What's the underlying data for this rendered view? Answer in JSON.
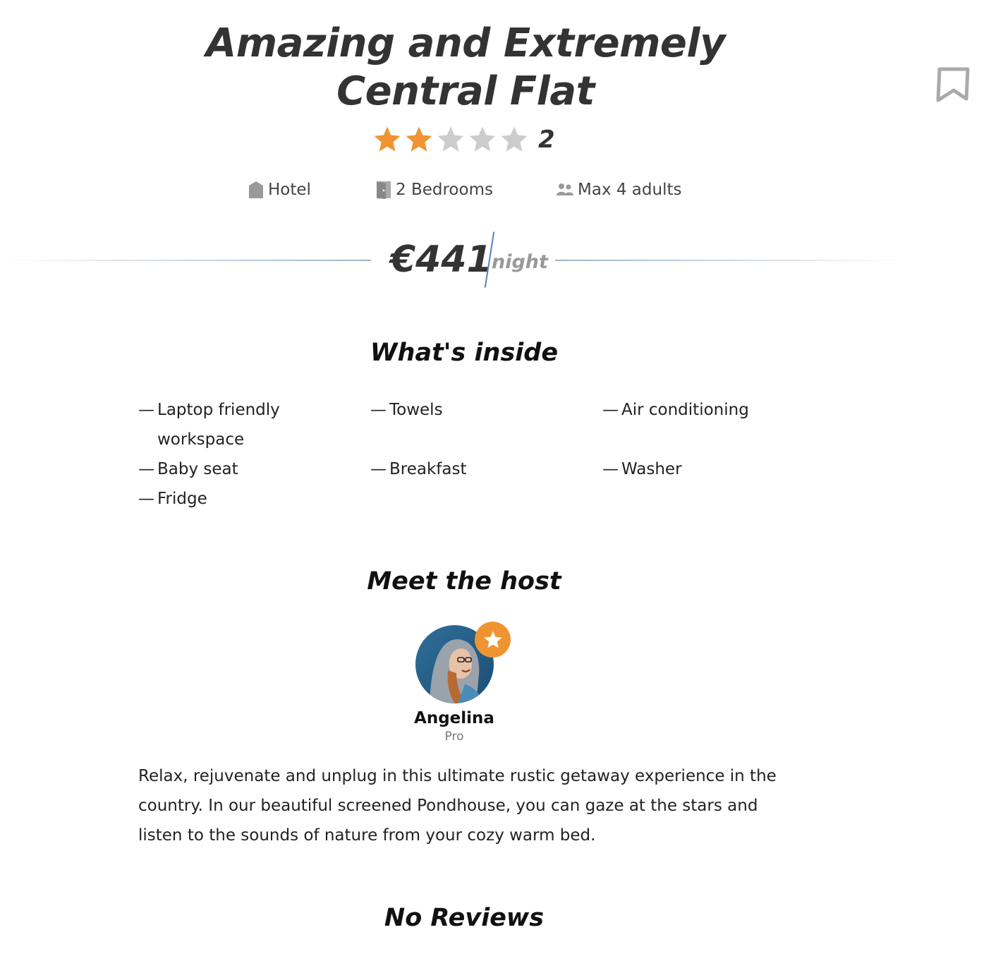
{
  "listing": {
    "title_line1": "Amazing and Extremely",
    "title_line2": "Central Flat",
    "rating": 2,
    "rating_max": 5,
    "rating_label": "2",
    "property_type": "Hotel",
    "bedrooms": "2 Bedrooms",
    "capacity": "Max 4 adults",
    "price": "€441",
    "price_unit": "night"
  },
  "bookmark": {
    "icon": "bookmark-icon"
  },
  "amenities": {
    "heading": "What's inside",
    "dash": "—",
    "items": [
      "Laptop friendly workspace",
      "Towels",
      "Air conditioning",
      "Baby seat",
      "Breakfast",
      "Washer",
      "Fridge"
    ]
  },
  "host": {
    "heading": "Meet the host",
    "name": "Angelina",
    "role": "Pro",
    "badge_icon": "star-icon",
    "description": "Relax, rejuvenate and unplug in this ultimate rustic getaway experience in the country. In our beautiful screened Pondhouse, you can gaze at the stars and listen to the sounds of nature from your cozy warm bed."
  },
  "reviews": {
    "heading": "No Reviews"
  },
  "colors": {
    "star_filled": "#f09433",
    "star_empty": "#cccccc",
    "accent_slash": "#5a7fc0",
    "icon_gray": "#999999"
  }
}
